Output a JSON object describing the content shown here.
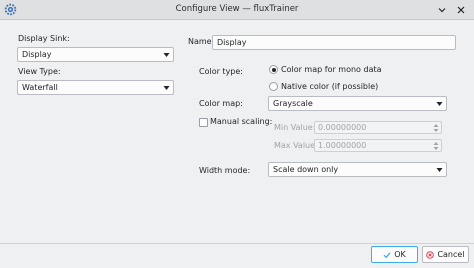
{
  "window": {
    "title": "Configure View — fluxTrainer"
  },
  "left": {
    "display_sink_label": "Display Sink:",
    "display_sink_value": "Display",
    "view_type_label": "View Type:",
    "view_type_value": "Waterfall"
  },
  "right": {
    "name_label": "Name:",
    "name_value": "Display",
    "color_type_label": "Color type:",
    "color_type_options": [
      "Color map for mono data",
      "Native color (if possible)"
    ],
    "color_type_selected": "Color map for mono data",
    "color_map_label": "Color map:",
    "color_map_value": "Grayscale",
    "manual_scaling_label": "Manual scaling:",
    "manual_scaling_checked": false,
    "min_value_label": "Min Value:",
    "min_value": "0.00000000",
    "max_value_label": "Max Value:",
    "max_value": "1.00000000",
    "width_mode_label": "Width mode:",
    "width_mode_value": "Scale down only"
  },
  "buttons": {
    "ok_label": "OK",
    "cancel_label": "Cancel"
  },
  "icons": {
    "app": "gear-icon",
    "minimize": "chevron-down-icon",
    "close": "close-icon",
    "ok": "check-icon",
    "cancel": "cancel-icon"
  },
  "colors": {
    "accent": "#3daee9",
    "titlebar": "#dee0e2",
    "background": "#eff0f1"
  }
}
